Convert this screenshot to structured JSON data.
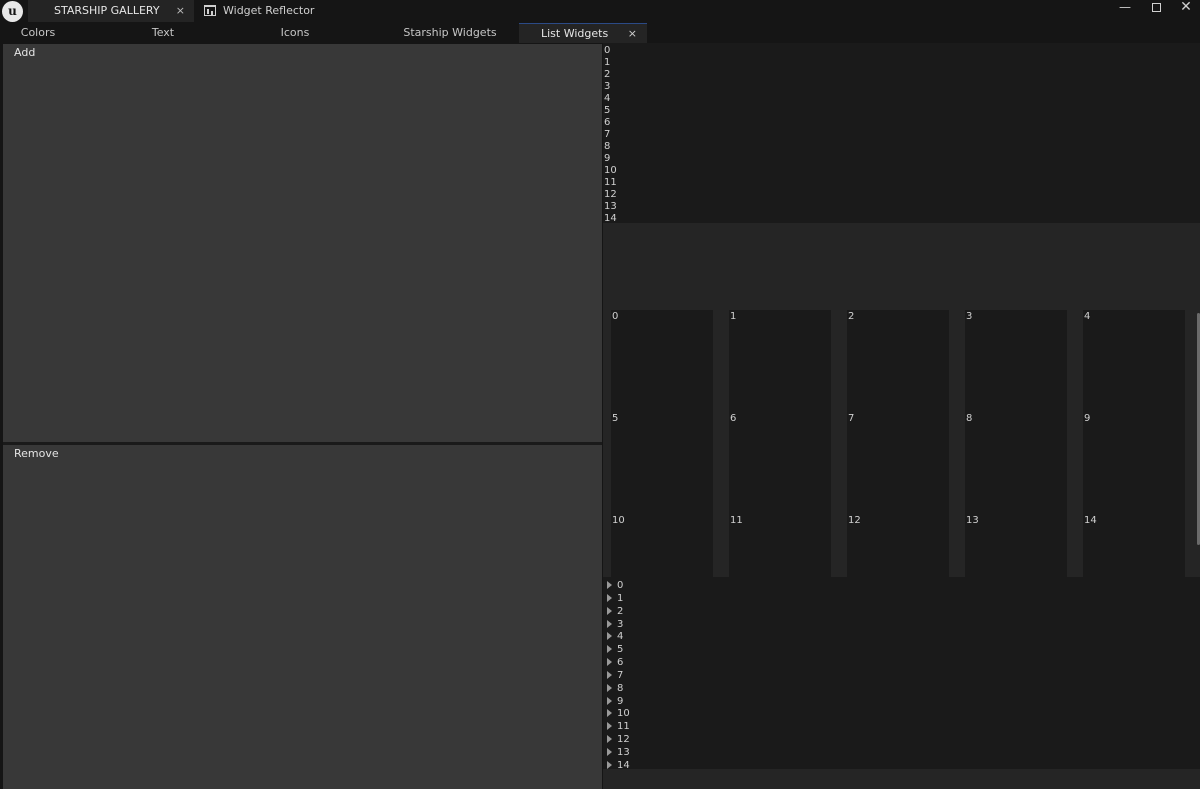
{
  "window": {
    "logo_glyph": "u",
    "tabs": [
      {
        "label": "STARSHIP GALLERY",
        "close": "×"
      },
      {
        "label": "Widget Reflector"
      }
    ],
    "controls": {
      "minimize": "—",
      "close": "✕"
    }
  },
  "tabs": [
    {
      "label": "Colors"
    },
    {
      "label": "Text"
    },
    {
      "label": "Icons"
    },
    {
      "label": "Starship Widgets"
    },
    {
      "label": "List Widgets",
      "close": "×",
      "active": true
    }
  ],
  "panels": {
    "add_label": "Add",
    "remove_label": "Remove"
  },
  "list_items": [
    "0",
    "1",
    "2",
    "3",
    "4",
    "5",
    "6",
    "7",
    "8",
    "9",
    "10",
    "11",
    "12",
    "13",
    "14"
  ],
  "tile_items": [
    "0",
    "1",
    "2",
    "3",
    "4",
    "5",
    "6",
    "7",
    "8",
    "9",
    "10",
    "11",
    "12",
    "13",
    "14"
  ],
  "tree_items": [
    "0",
    "1",
    "2",
    "3",
    "4",
    "5",
    "6",
    "7",
    "8",
    "9",
    "10",
    "11",
    "12",
    "13",
    "14"
  ],
  "colors": {
    "accent": "#2b4a86",
    "panel": "#383838",
    "background": "#151515",
    "list_background": "#1a1a1a"
  },
  "icons": {
    "logo": "unreal-logo-icon",
    "reflector": "widget-reflector-icon",
    "tree_expander": "triangle-right-icon"
  }
}
